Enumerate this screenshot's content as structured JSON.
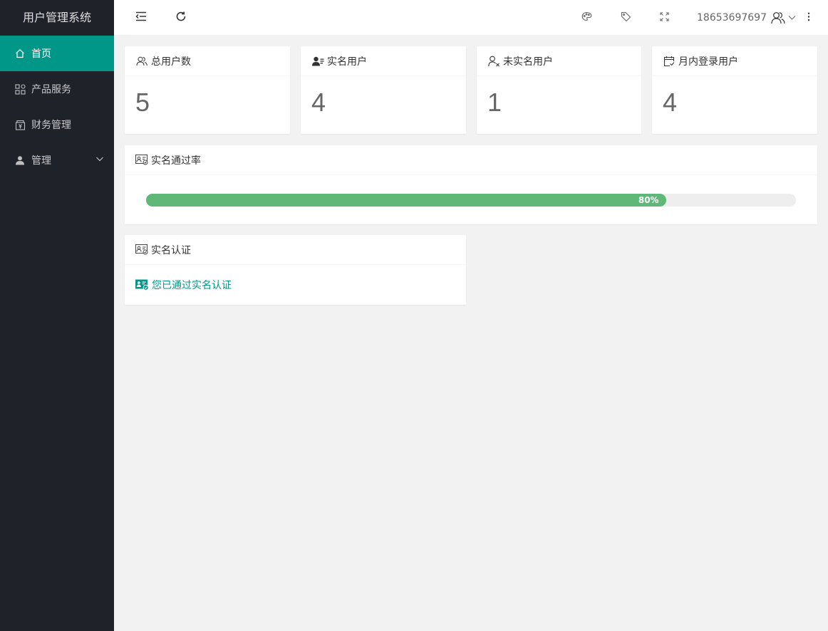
{
  "app": {
    "title": "用户管理系统"
  },
  "sidebar": {
    "items": [
      {
        "label": "首页",
        "icon": "home-icon",
        "active": true
      },
      {
        "label": "产品服务",
        "icon": "apps-grid-icon"
      },
      {
        "label": "财务管理",
        "icon": "finance-icon"
      },
      {
        "label": "管理",
        "icon": "user-icon",
        "expandable": true
      }
    ]
  },
  "header": {
    "username": "18653697697",
    "icons": [
      "menu-fold-icon",
      "refresh-icon",
      "theme-icon",
      "tag-icon",
      "fullscreen-icon",
      "user-group-icon",
      "chevron-down-icon",
      "more-vertical-icon"
    ]
  },
  "stats": [
    {
      "label": "总用户数",
      "value": "5",
      "icon": "users-outline-icon"
    },
    {
      "label": "实名用户",
      "value": "4",
      "icon": "user-verified-icon"
    },
    {
      "label": "未实名用户",
      "value": "1",
      "icon": "user-unverified-icon"
    },
    {
      "label": "月内登录用户",
      "value": "4",
      "icon": "calendar-check-icon"
    }
  ],
  "pass_rate": {
    "title": "实名通过率",
    "percent": 80,
    "text": "80%",
    "color": "#5fb878"
  },
  "verification": {
    "title": "实名认证",
    "status_text": "您已通过实名认证",
    "color": "#009688"
  },
  "colors": {
    "sidebar_bg": "#20222a",
    "accent": "#009688",
    "page_bg": "#f2f2f2"
  }
}
